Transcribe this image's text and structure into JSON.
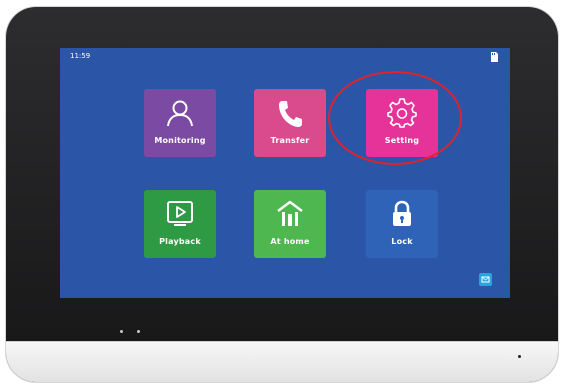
{
  "status": {
    "time": "11:59"
  },
  "tiles": [
    {
      "label": "Monitoring",
      "color": "#7b4aa3",
      "icon": "user-icon"
    },
    {
      "label": "Transfer",
      "color": "#d94b8d",
      "icon": "phone-icon"
    },
    {
      "label": "Setting",
      "color": "#e6339a",
      "icon": "gear-icon"
    },
    {
      "label": "Playback",
      "color": "#2f9a44",
      "icon": "play-icon"
    },
    {
      "label": "At home",
      "color": "#4fb74f",
      "icon": "home-icon"
    },
    {
      "label": "Lock",
      "color": "#2f63b8",
      "icon": "lock-icon"
    }
  ],
  "colors": {
    "screen_background": "#2b55a6",
    "highlight_circle": "#e0222d",
    "corner_button": "#29a4e0"
  }
}
